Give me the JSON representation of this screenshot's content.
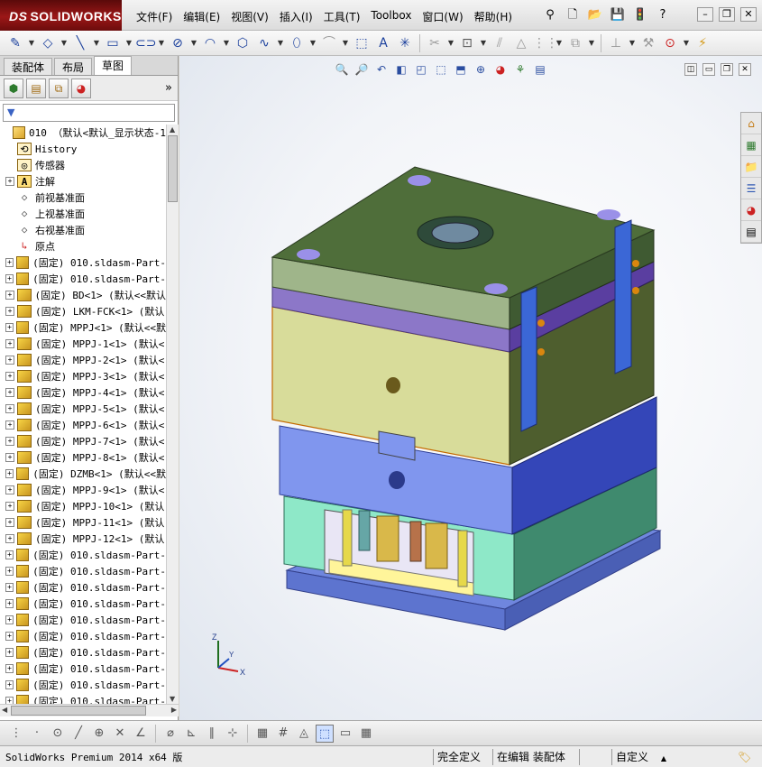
{
  "app": {
    "brand": "SOLIDWORKS",
    "brand_prefix": "DS"
  },
  "menu": [
    "文件(F)",
    "编辑(E)",
    "视图(V)",
    "插入(I)",
    "工具(T)",
    "Toolbox",
    "窗口(W)",
    "帮助(H)"
  ],
  "panel": {
    "tabs": [
      "装配体",
      "布局",
      "草图"
    ],
    "active_tab": "草图",
    "more": "»",
    "filter": "▼"
  },
  "tree": {
    "root": "010 （默认<默认_显示状态-1",
    "items": [
      {
        "label": "History",
        "icon": "history-icon",
        "expand": ""
      },
      {
        "label": "传感器",
        "icon": "sensor-icon",
        "expand": ""
      },
      {
        "label": "注解",
        "icon": "annotation-icon",
        "expand": "+"
      },
      {
        "label": "前视基准面",
        "icon": "plane-icon",
        "expand": ""
      },
      {
        "label": "上视基准面",
        "icon": "plane-icon",
        "expand": ""
      },
      {
        "label": "右视基准面",
        "icon": "plane-icon",
        "expand": ""
      },
      {
        "label": "原点",
        "icon": "origin-icon",
        "expand": ""
      },
      {
        "label": "(固定) 010.sldasm-Part-",
        "icon": "part-icon",
        "expand": "+"
      },
      {
        "label": "(固定) 010.sldasm-Part-",
        "icon": "part-icon",
        "expand": "+"
      },
      {
        "label": "(固定) BD<1> (默认<<默认",
        "icon": "part-icon",
        "expand": "+"
      },
      {
        "label": "(固定) LKM-FCK<1> (默认",
        "icon": "part-icon",
        "expand": "+"
      },
      {
        "label": "(固定) MPPJ<1> (默认<<默",
        "icon": "part-icon",
        "expand": "+"
      },
      {
        "label": "(固定) MPPJ-1<1> (默认<",
        "icon": "part-icon",
        "expand": "+"
      },
      {
        "label": "(固定) MPPJ-2<1> (默认<",
        "icon": "part-icon",
        "expand": "+"
      },
      {
        "label": "(固定) MPPJ-3<1> (默认<",
        "icon": "part-icon",
        "expand": "+"
      },
      {
        "label": "(固定) MPPJ-4<1> (默认<",
        "icon": "part-icon",
        "expand": "+"
      },
      {
        "label": "(固定) MPPJ-5<1> (默认<",
        "icon": "part-icon",
        "expand": "+"
      },
      {
        "label": "(固定) MPPJ-6<1> (默认<",
        "icon": "part-icon",
        "expand": "+"
      },
      {
        "label": "(固定) MPPJ-7<1> (默认<",
        "icon": "part-icon",
        "expand": "+"
      },
      {
        "label": "(固定) MPPJ-8<1> (默认<",
        "icon": "part-icon",
        "expand": "+"
      },
      {
        "label": "(固定) DZMB<1> (默认<<默",
        "icon": "part-icon",
        "expand": "+"
      },
      {
        "label": "(固定) MPPJ-9<1> (默认<",
        "icon": "part-icon",
        "expand": "+"
      },
      {
        "label": "(固定) MPPJ-10<1> (默认",
        "icon": "part-icon",
        "expand": "+"
      },
      {
        "label": "(固定) MPPJ-11<1> (默认",
        "icon": "part-icon",
        "expand": "+"
      },
      {
        "label": "(固定) MPPJ-12<1> (默认",
        "icon": "part-icon",
        "expand": "+"
      },
      {
        "label": "(固定) 010.sldasm-Part-",
        "icon": "part-icon",
        "expand": "+"
      },
      {
        "label": "(固定) 010.sldasm-Part-",
        "icon": "part-icon",
        "expand": "+"
      },
      {
        "label": "(固定) 010.sldasm-Part-",
        "icon": "part-icon",
        "expand": "+"
      },
      {
        "label": "(固定) 010.sldasm-Part-",
        "icon": "part-icon",
        "expand": "+"
      },
      {
        "label": "(固定) 010.sldasm-Part-",
        "icon": "part-icon",
        "expand": "+"
      },
      {
        "label": "(固定) 010.sldasm-Part-",
        "icon": "part-icon",
        "expand": "+"
      },
      {
        "label": "(固定) 010.sldasm-Part-",
        "icon": "part-icon",
        "expand": "+"
      },
      {
        "label": "(固定) 010.sldasm-Part-",
        "icon": "part-icon",
        "expand": "+"
      },
      {
        "label": "(固定) 010.sldasm-Part-",
        "icon": "part-icon",
        "expand": "+"
      },
      {
        "label": "(固定) 010.sldasm-Part-",
        "icon": "part-icon",
        "expand": "+"
      },
      {
        "label": "(固定) 010.sldasm-Part-",
        "icon": "part-icon",
        "expand": "+"
      }
    ]
  },
  "triad": {
    "x": "X",
    "y": "Y",
    "z": "Z"
  },
  "status": {
    "product": "SolidWorks Premium 2014 x64 版",
    "definition": "完全定义",
    "mode": "在编辑 装配体",
    "units": "自定义",
    "units_arrow": "▲"
  },
  "colors": {
    "brand_red": "#9c1717",
    "plate_green": "#4f6e3a",
    "plate_yellow": "#d8dc9a",
    "plate_blue": "#7f95e8",
    "plate_mint": "#8ee8c8",
    "rail_blue": "#3b67d6",
    "plate_purple": "#8c77c8"
  }
}
